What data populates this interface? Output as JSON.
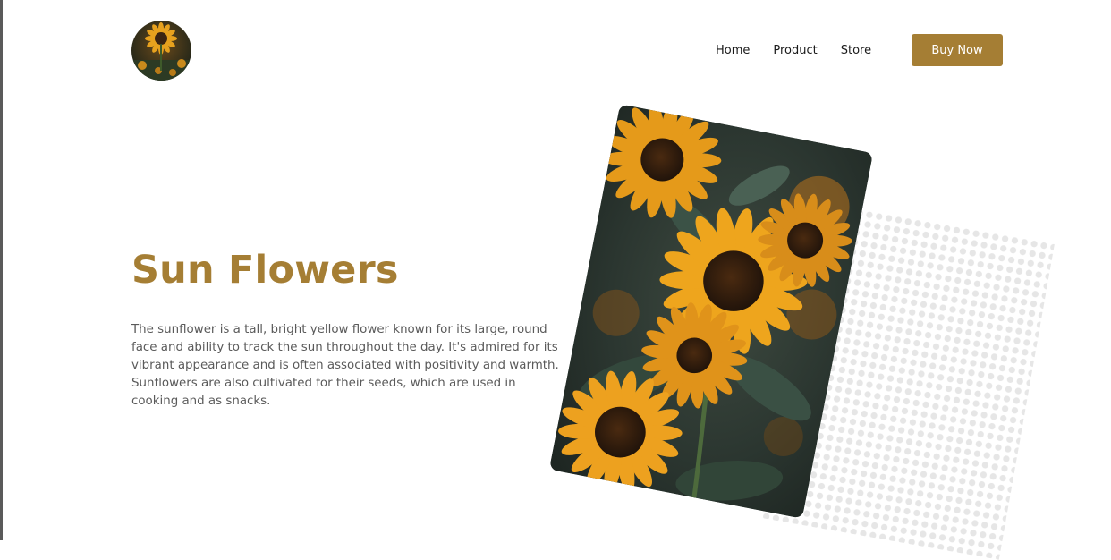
{
  "header": {
    "logo_icon": "sunflower-avatar-icon",
    "nav": {
      "home": "Home",
      "product": "Product",
      "store": "Store"
    },
    "buy_button": "Buy Now"
  },
  "hero": {
    "title": "Sun Flowers",
    "description": "The sunflower is a tall, bright yellow flower known for its large, round face and ability to track the sun throughout the day. It's admired for its vibrant appearance and is often associated with positivity and warmth. Sunflowers are also cultivated for their seeds, which are used in cooking and as snacks.",
    "image_icon": "sunflowers-photo-icon"
  },
  "colors": {
    "accent": "#a57e34",
    "text": "#5a5a5a",
    "nav_text": "#1a1a1a",
    "dots": "#e6e6e6"
  }
}
